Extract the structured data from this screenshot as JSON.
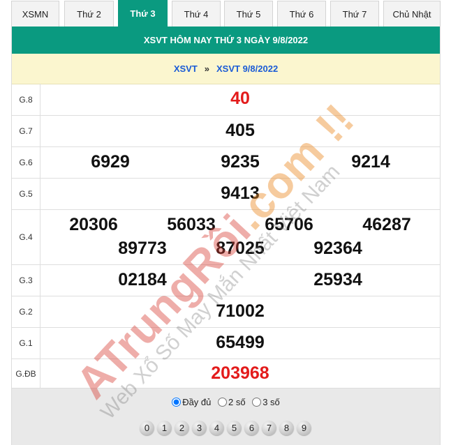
{
  "tabs": [
    "XSMN",
    "Thứ 2",
    "Thứ 3",
    "Thứ 4",
    "Thứ 5",
    "Thứ 6",
    "Thứ 7",
    "Chủ Nhật"
  ],
  "active_tab": "Thứ 3",
  "title": "XSVT HÔM NAY THỨ 3 NGÀY 9/8/2022",
  "breadcrumb": {
    "home": "XSVT",
    "separator": "»",
    "current": "XSVT 9/8/2022"
  },
  "prizes": [
    {
      "label": "G.8",
      "numbers": [
        "40"
      ]
    },
    {
      "label": "G.7",
      "numbers": [
        "405"
      ]
    },
    {
      "label": "G.6",
      "numbers": [
        "6929",
        "9235",
        "9214"
      ]
    },
    {
      "label": "G.5",
      "numbers": [
        "9413"
      ]
    },
    {
      "label": "G.4",
      "numbers": [
        "20306",
        "56033",
        "65706",
        "46287",
        "89773",
        "87025",
        "92364"
      ]
    },
    {
      "label": "G.3",
      "numbers": [
        "02184",
        "25934"
      ]
    },
    {
      "label": "G.2",
      "numbers": [
        "71002"
      ]
    },
    {
      "label": "G.1",
      "numbers": [
        "65499"
      ]
    },
    {
      "label": "G.ĐB",
      "numbers": [
        "203968"
      ]
    }
  ],
  "display_options": {
    "full": "Đầy đủ",
    "two": "2 số",
    "three": "3 số",
    "selected": "full"
  },
  "digits": [
    "0",
    "1",
    "2",
    "3",
    "4",
    "5",
    "6",
    "7",
    "8",
    "9"
  ],
  "watermark": {
    "brand_a": "ATrungRồi",
    "brand_b": ".com !!",
    "slogan": "Web Xổ Số May Mắn Nhất Việt Nam"
  },
  "colors": {
    "accent": "#0a9a80",
    "highlight": "#e31b1b",
    "breadcrumb_bg": "#fbf6cf",
    "link": "#1a5bd6"
  }
}
